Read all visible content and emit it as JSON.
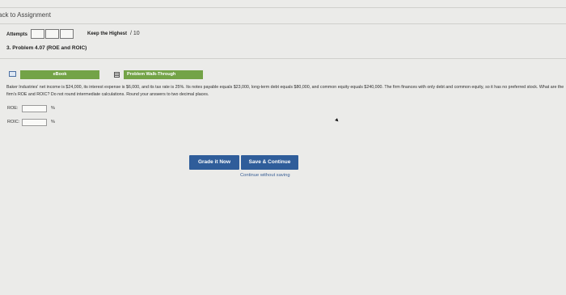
{
  "nav": {
    "back_label": "ack to Assignment"
  },
  "attempts": {
    "label": "Attempts",
    "keep_label": "Keep the Highest",
    "score": "/ 10"
  },
  "problem": {
    "title": "3. Problem 4.07 (ROE and ROIC)",
    "ebook_label": "eBook",
    "walkthrough_label": "Problem Walk-Through",
    "text": "Baker Industries' net income is $24,000, its interest expense is $6,000, and its tax rate is 25%. Its notes payable equals $23,000, long-term debt equals $80,000, and common equity equals $240,000. The firm finances with only debt and common equity, so it has no preferred stock. What are the firm's ROE and ROIC? Do not round intermediate calculations. Round your answers to two decimal places."
  },
  "fields": [
    {
      "label": "ROE:",
      "value": "",
      "unit": "%"
    },
    {
      "label": "ROIC:",
      "value": "",
      "unit": "%"
    }
  ],
  "actions": {
    "grade_label": "Grade it Now",
    "save_label": "Save & Continue",
    "continue_label": "Continue without saving"
  },
  "colors": {
    "accent_green": "#73a347",
    "button_blue": "#2f5d9a",
    "link_blue": "#3a5f95"
  }
}
